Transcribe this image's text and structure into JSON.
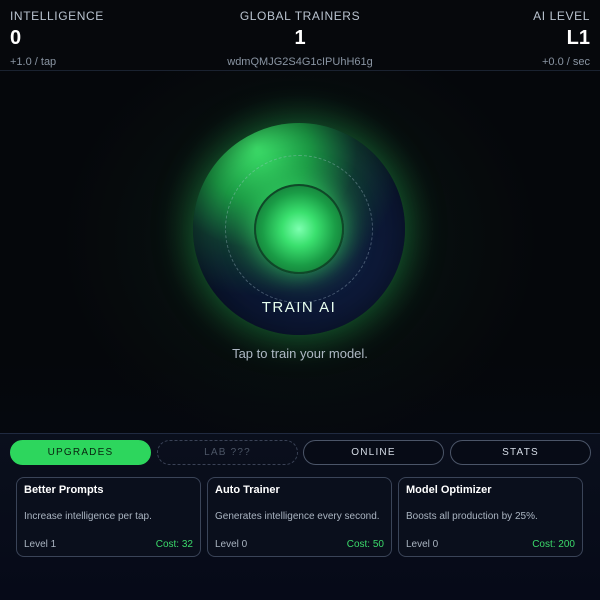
{
  "header": {
    "intelligence": {
      "label": "INTELLIGENCE",
      "value": "0",
      "rate": "+1.0 / tap"
    },
    "trainers": {
      "label": "GLOBAL TRAINERS",
      "value": "1",
      "id": "wdmQMJG2S4G1cIPUhH61g"
    },
    "ai_level": {
      "label": "AI LEVEL",
      "value": "L1",
      "rate": "+0.0 / sec"
    }
  },
  "core": {
    "label": "TRAIN AI",
    "hint": "Tap to train your model."
  },
  "tabs": [
    {
      "label": "UPGRADES",
      "active": true
    },
    {
      "label": "LAB ???",
      "locked": true
    },
    {
      "label": "ONLINE"
    },
    {
      "label": "STATS"
    }
  ],
  "upgrades": [
    {
      "title": "Better Prompts",
      "desc": "Increase intelligence per tap.",
      "level": "Level 1",
      "cost": "Cost: 32"
    },
    {
      "title": "Auto Trainer",
      "desc": "Generates intelligence every second.",
      "level": "Level 0",
      "cost": "Cost: 50"
    },
    {
      "title": "Model Optimizer",
      "desc": "Boosts all production by 25%.",
      "level": "Level 0",
      "cost": "Cost: 200"
    }
  ],
  "colors": {
    "accent": "#2dd65d",
    "background": "#05070b"
  }
}
